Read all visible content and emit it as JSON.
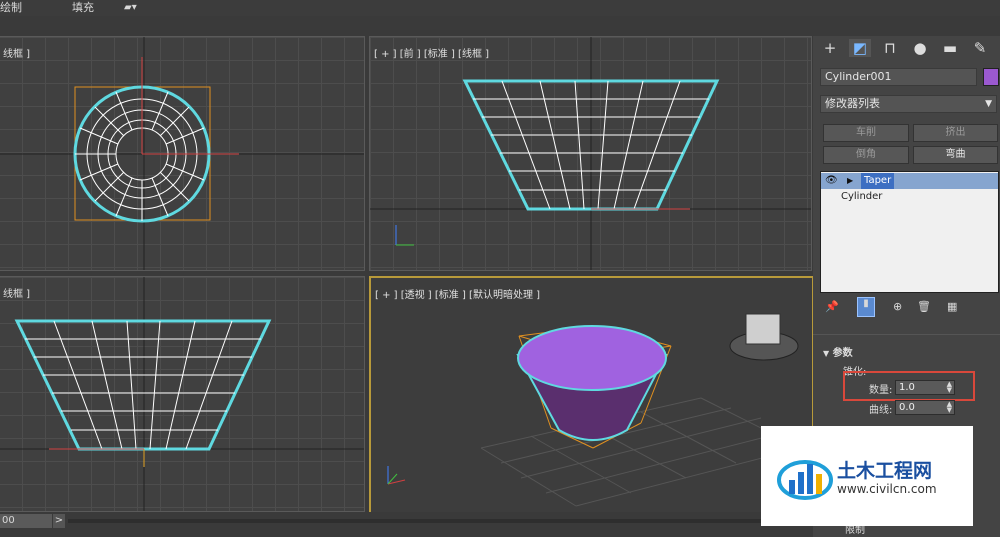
{
  "menu": {
    "draw": "绘制",
    "fill": "填充"
  },
  "viewports": {
    "top_left_label": "线框 ]",
    "top_right_label": "[ + ] [前 ] [标准 ] [线框 ]",
    "bottom_left_label": "线框 ]",
    "perspective_label": "[ + ] [透视 ] [标准 ] [默认明暗处理 ]"
  },
  "panel": {
    "object_name": "Cylinder001",
    "object_color": "#9b59d0",
    "modifier_list": "修改器列表",
    "buttons": [
      "车削",
      "挤出",
      "倒角",
      "弯曲"
    ],
    "stack": [
      "Taper",
      "Cylinder"
    ],
    "rollout_title": "参数",
    "group_label": "锥化:",
    "amount_label": "数量:",
    "amount_value": "1.0",
    "curve_label": "曲线:",
    "curve_value": "0.0",
    "partial_label": "限制"
  },
  "bottom": {
    "frame_value": "00",
    "arrow": ">"
  },
  "watermark": {
    "title": "土木工程网",
    "url": "www.civilcn.com"
  },
  "colors": {
    "accent_cyan": "#5fd9e0",
    "highlight_red": "#d9483b",
    "selection_purple": "#9b59d0",
    "bbox_orange": "#e09020"
  }
}
